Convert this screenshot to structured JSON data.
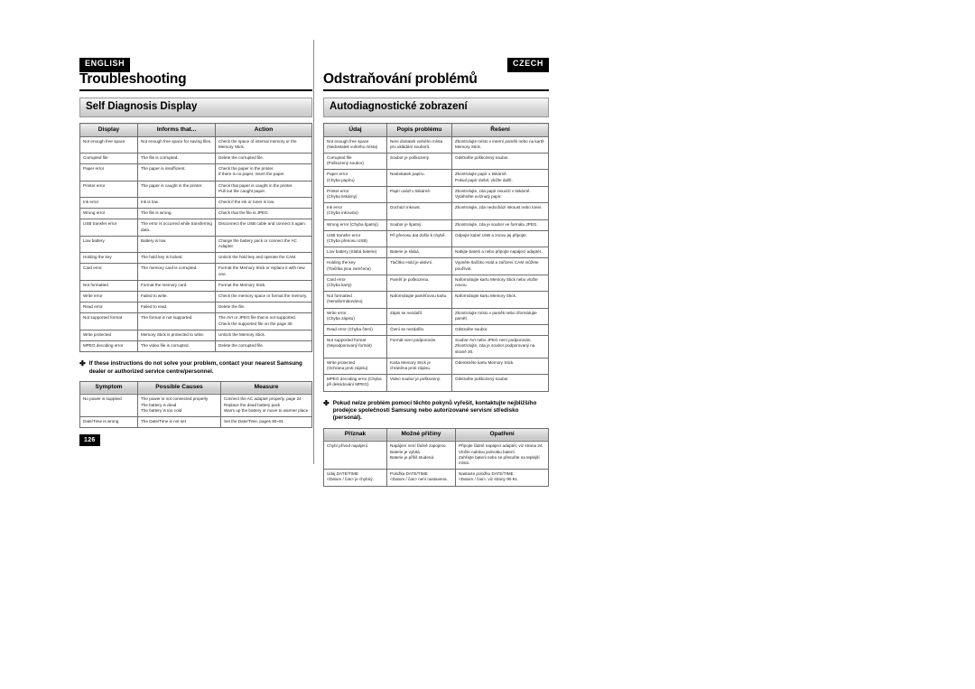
{
  "left": {
    "lang_tag": "ENGLISH",
    "chapter_title": "Troubleshooting",
    "section_title": "Self Diagnosis Display",
    "diag_headers": [
      "Display",
      "Informs that...",
      "Action"
    ],
    "diag_rows": [
      [
        "Not enough free space",
        "Not enough free space for saving files.",
        "Check the space of internal memory or the Memory Stick."
      ],
      [
        "Corrupted file",
        "The file is corrupted.",
        "Delete the corrupted file."
      ],
      [
        "Paper error",
        "The paper is insufficient.",
        "Check the paper in the printer.\nIf there is no paper, insert the paper."
      ],
      [
        "Printer error",
        "The paper is caught in the printer.",
        "Check that paper is caught in the printer.\nPull out the caught paper."
      ],
      [
        "Ink error",
        "Ink is low.",
        "Check if the ink or toner is low."
      ],
      [
        "Wrong error",
        "The file is wrong.",
        "Check that the file is JPEG."
      ],
      [
        "USB transfer error",
        "The error is occurred while transferring data.",
        "Disconnect the USB cable and connect it again."
      ],
      [
        "Low battery",
        "Battery is low.",
        "Charge the battery pack or connect the AC Adapter."
      ],
      [
        "Holding the key",
        "The hold key is locked.",
        "Unlock the hold key and operate the CAM."
      ],
      [
        "Card error",
        "The memory card is corrupted.",
        "Format the Memory Stick or replace it with new one."
      ],
      [
        "Not formatted",
        "Format the memory card.",
        "Format the Memory Stick."
      ],
      [
        "Write error",
        "Failed to write.",
        "Check the memory space or format the memory."
      ],
      [
        "Read error",
        "Failed to read.",
        "Delete the file."
      ],
      [
        "Not supported format",
        "The format is not supported.",
        "The AVI or JPEG file that is not supported. Check the supported file on the page 30."
      ],
      [
        "Write protected",
        "Memory Stick is protected to write.",
        "Unlock the Memory Stick."
      ],
      [
        "MPEG decoding error",
        "The video file is corrupted.",
        "Delete the corrupted file."
      ]
    ],
    "note_bullet": "✤",
    "note_text": "If these instructions do not solve your problem, contact your nearest Samsung dealer or authorized service centre/personnel.",
    "symptom_headers": [
      "Symptom",
      "Possible Causes",
      "Measure"
    ],
    "symptom_rows": [
      [
        "No power is supplied",
        "The power is not connected properly\nThe battery is dead\nThe battery is too cold",
        "Connect the AC adapter properly, page 24\nReplace the dead battery pack\nWarm up the battery or move to warmer place"
      ],
      [
        "Date/Time is wrong",
        "The Date/Time is not set",
        "Set the Date/Time, pages 90~91"
      ]
    ],
    "page_number": "126"
  },
  "right": {
    "lang_tag": "CZECH",
    "chapter_title": "Odstraňování problémů",
    "section_title": "Autodiagnostické zobrazení",
    "diag_headers": [
      "Údaj",
      "Popis problému",
      "Řešení"
    ],
    "diag_rows": [
      [
        "Not enough free space\n(Nedostatek volného místa)",
        "Není dostatek volného místa pro ukládání souborů.",
        "Zkontrolujte místo v interní paměti nebo na kartě Memory Stick."
      ],
      [
        "Corrupted file\n(Poškozený soubor)",
        "Soubor je poškozený.",
        "Odstraňte poškozený soubor."
      ],
      [
        "Paper error\n(Chyba papíru)",
        "Nedostatek papíru.",
        "Zkontrolujte papír v tiskárně.\nPokud papír došel, vložte další."
      ],
      [
        "Printer error\n(Chyba tiskárny)",
        "Papír uvázl v tiskárně.",
        "Zkontrolujte, zda papír neuvízl v tiskárně.\nVytáhněte uvíznutý papír."
      ],
      [
        "Ink error\n(Chyba inkoustu)",
        "Dochází inkoust.",
        "Zkontrolujte, zda nedochází inkoust nebo toner."
      ],
      [
        "Wrong error (Chyba špatný)",
        "Soubor je špatný.",
        "Zkontrolujte, zda je soubor ve formátu JPEG."
      ],
      [
        "USB transfer error\n(Chyba přenosu USB)",
        "Při přenosu dat došlo k chybě.",
        "Odpojte kabel USB a znovu jej připojte."
      ],
      [
        "Low battery (Slabá baterie)",
        "Baterie je slabá.",
        "Nabijte baterii a nebo připojte napájecí adaptér."
      ],
      [
        "Holding the key\n(Tlačítka jsou zamčena)",
        "Tlačítko Hold je aktivní.",
        "Vypněte tlačítko Hold a zařízení CAM můžete používat."
      ],
      [
        "Card error\n(Chyba karty)",
        "Paměť je poškozena.",
        "Naformátujte kartu Memory Stick nebo vložte novou."
      ],
      [
        "Not formatted\n(Nenaformátováno)",
        "Naformátujte paměťovou kartu.",
        "Naformátujte kartu Memory Stick."
      ],
      [
        "Write error\n(Chyba zápisu)",
        "Zápis se nezdařil.",
        "Zkontrolujte místo v paměti nebo zformátujte paměť."
      ],
      [
        "Read error (Chyba čtení)",
        "Čtení se nezdařilo.",
        "Odstraňte soubor."
      ],
      [
        "Not supported format\n(Nepodporovaný formát)",
        "Formát není podporován.",
        "Soubor AVI nebo JPEG není podporován. Zkontrolujte, zda je soubor podporovaný na straně 30."
      ],
      [
        "Write protected\n(Ochrana proti zápisu)",
        "Karta Memory Stick je chráněna proti zápisu.",
        "Odemkněte kartu Memory Stick."
      ],
      [
        "MPEG decoding error (Chyba při dekódování MPEG)",
        "Video soubor je poškozený.",
        "Odstraňte poškozený soubor."
      ]
    ],
    "note_bullet": "✤",
    "note_text": "Pokud nelze problém pomocí těchto pokynů vyřešit, kontaktujte nejbližšího prodejce společnosti Samsung nebo autorizované servisní středisko (personál).",
    "symptom_headers": [
      "Příznak",
      "Možné příčiny",
      "Opatření"
    ],
    "symptom_rows": [
      [
        "Chybí přívod napájení.",
        "Napájení není řádně zapojeno.\nBaterie je vybitá.\nBaterie je příliš studená.",
        "Připojte řádně napájecí adaptér, viz strana 24.\nVložte nabitou jednotku baterií.\nZahřejte baterii nebo se přesuňte na teplejší místo."
      ],
      [
        "Údaj DATE/TIME\n<Datum / čas> je chybný.",
        "Položka DATE/TIME\n<Datum / čas> není nastavena.",
        "Nastavte položku DATE/TIME\n<Datum / čas>, viz strany 90-91."
      ]
    ]
  }
}
